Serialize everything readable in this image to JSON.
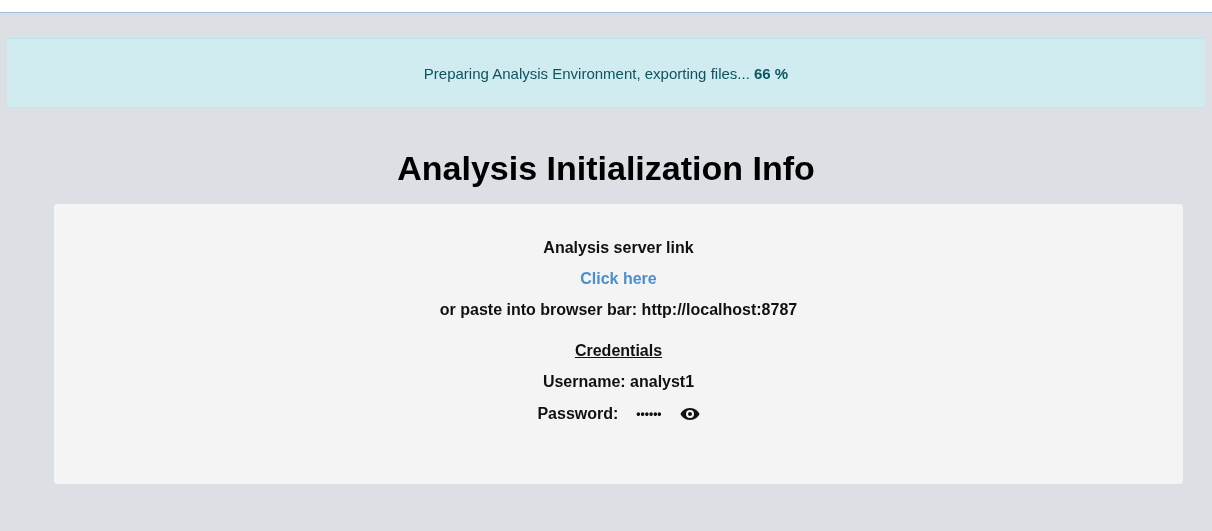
{
  "alert": {
    "message": "Preparing Analysis Environment, exporting files... **66 %**"
  },
  "heading": "Analysis Initialization Info",
  "card": {
    "link_title": "Analysis server link",
    "link_text": "Click here",
    "paste_hint": "or paste into browser bar: http://localhost:8787",
    "credentials_title": "Credentials",
    "username": "Username: analyst1",
    "password_label": "Password:",
    "password_value": "••••••"
  }
}
